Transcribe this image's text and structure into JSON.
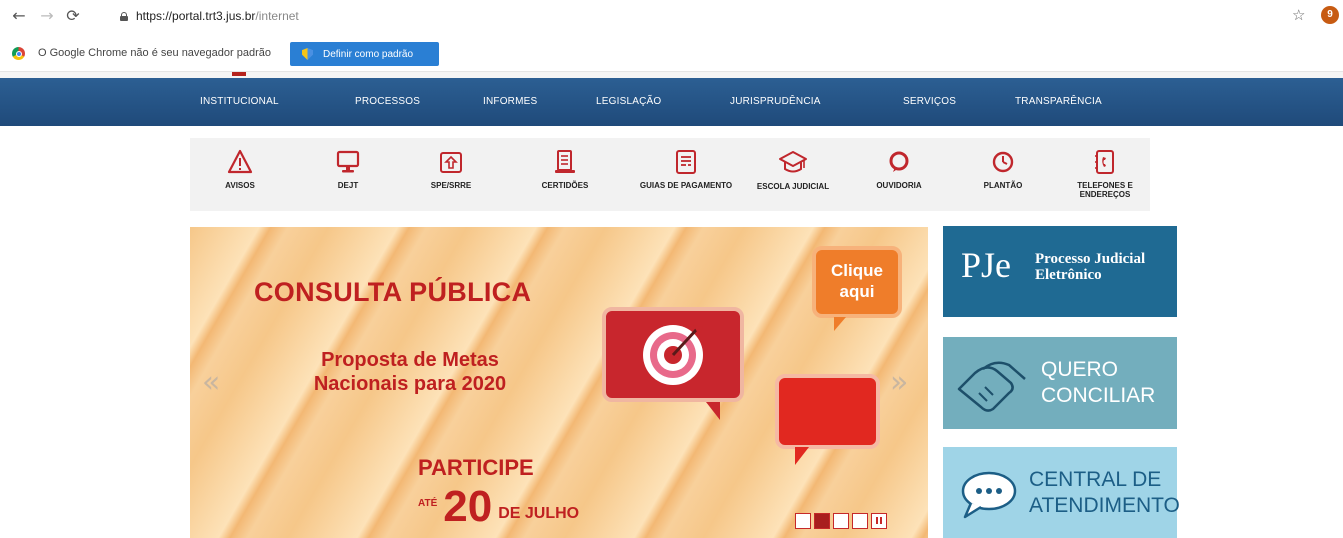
{
  "browser": {
    "url_host": "https://portal.trt3.jus.br",
    "url_path": "/internet",
    "profile_initial": "9",
    "infobar_text": "O Google Chrome não é seu navegador padrão",
    "default_button_label": "Definir como padrão"
  },
  "nav": {
    "items": [
      {
        "label": "INSTITUCIONAL"
      },
      {
        "label": "PROCESSOS"
      },
      {
        "label": "INFORMES"
      },
      {
        "label": "LEGISLAÇÃO"
      },
      {
        "label": "JURISPRUDÊNCIA"
      },
      {
        "label": "SERVIÇOS"
      },
      {
        "label": "TRANSPARÊNCIA"
      }
    ]
  },
  "quick_links": {
    "items": [
      {
        "label": "AVISOS",
        "icon": "warning-icon"
      },
      {
        "label": "DEJT",
        "icon": "monitor-icon"
      },
      {
        "label": "SPE/SRRE",
        "icon": "upload-icon"
      },
      {
        "label": "CERTIDÕES",
        "icon": "certificate-icon"
      },
      {
        "label": "GUIAS DE PAGAMENTO",
        "icon": "invoice-icon"
      },
      {
        "label": "ESCOLA JUDICIAL",
        "icon": "graduation-cap-icon"
      },
      {
        "label": "OUVIDORIA",
        "icon": "speech-icon"
      },
      {
        "label": "PLANTÃO",
        "icon": "clock-icon"
      },
      {
        "label": "TELEFONES E ENDEREÇOS",
        "icon": "phone-book-icon"
      }
    ]
  },
  "banner": {
    "title": "CONSULTA PÚBLICA",
    "subtitle": "Proposta de Metas Nacionais para 2020",
    "cta": "PARTICIPE",
    "date_prefix": "ATÉ",
    "date_day": "20",
    "date_month": "DE JULHO",
    "clique_label": "Clique aqui",
    "active_slide": 2,
    "slide_count": 4
  },
  "tiles": {
    "pje_logo": "PJe",
    "pje_line1": "Processo Judicial",
    "pje_line2": "Eletrônico",
    "conciliar_line1": "QUERO",
    "conciliar_line2": "CONCILIAR",
    "central_line1": "CENTRAL DE",
    "central_line2": "ATENDIMENTO"
  },
  "colors": {
    "nav_bg": "#1f4a7a",
    "banner_red": "#bf2020",
    "icon_red": "#c0272d",
    "pje_bg": "#1f6a93",
    "conciliar_bg": "#73aebd",
    "central_bg": "#9fd4e7"
  }
}
